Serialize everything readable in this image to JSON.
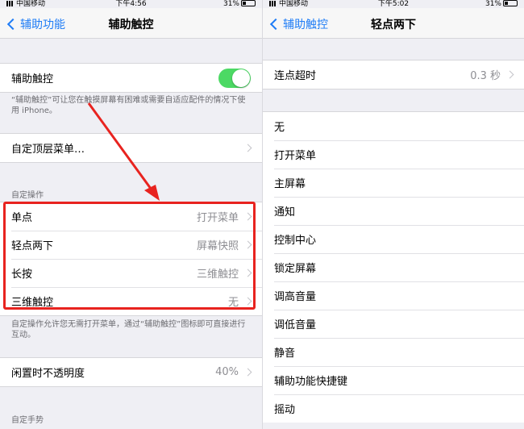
{
  "left": {
    "status": {
      "carrier": "中国移动",
      "time": "下午4:56",
      "battery": "31%"
    },
    "nav": {
      "back": "辅助功能",
      "title": "辅助触控"
    },
    "toggle_row": {
      "label": "辅助触控",
      "on": true
    },
    "toggle_footnote": "“辅助触控”可让您在触摸屏幕有困难或需要自适应配件的情况下使用 iPhone。",
    "top_menu": {
      "label": "自定顶层菜单…"
    },
    "custom_section": "自定操作",
    "actions": [
      {
        "label": "单点",
        "value": "打开菜单"
      },
      {
        "label": "轻点两下",
        "value": "屏幕快照"
      },
      {
        "label": "长按",
        "value": "三维触控"
      },
      {
        "label": "三维触控",
        "value": "无"
      }
    ],
    "actions_footnote": "自定操作允许您无需打开菜单，通过“辅助触控”图标即可直接进行互动。",
    "idle": {
      "label": "闲置时不透明度",
      "value": "40%"
    },
    "gesture_section": "自定手势"
  },
  "right": {
    "status": {
      "carrier": "中国移动",
      "time": "下午5:02",
      "battery": "31%"
    },
    "nav": {
      "back": "辅助触控",
      "title": "轻点两下"
    },
    "timeout": {
      "label": "连点超时",
      "value": "0.3 秒"
    },
    "options": [
      "无",
      "打开菜单",
      "主屏幕",
      "通知",
      "控制中心",
      "锁定屏幕",
      "调高音量",
      "调低音量",
      "静音",
      "辅助功能快捷键",
      "摇动"
    ]
  },
  "colors": {
    "accent": "#1e7cf6",
    "toggle_on": "#4cd964",
    "highlight": "#e8231f"
  }
}
